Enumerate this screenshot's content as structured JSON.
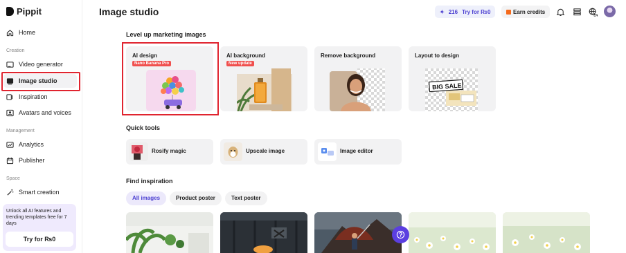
{
  "app": {
    "name": "Pippit"
  },
  "sidebar": {
    "home": "Home",
    "creation_label": "Creation",
    "creation_items": [
      "Video generator",
      "Image studio",
      "Inspiration",
      "Avatars and voices"
    ],
    "management_label": "Management",
    "management_items": [
      "Analytics",
      "Publisher"
    ],
    "space_label": "Space",
    "space_items": [
      "Smart creation"
    ],
    "promo": {
      "text": "Unlock all AI features and trending templates free for 7 days",
      "button": "Try for ₨0"
    }
  },
  "header": {
    "title": "Image studio",
    "credits": "216",
    "try_label": "Try for ₨0",
    "earn_label": "Earn credits"
  },
  "level_up": {
    "heading": "Level up marketing images",
    "cards": [
      {
        "title": "AI design",
        "badge": "Nano Banana Pro"
      },
      {
        "title": "AI background",
        "badge": "New update"
      },
      {
        "title": "Remove background",
        "badge": ""
      },
      {
        "title": "Layout to design",
        "badge": ""
      }
    ],
    "big_sale": "BIG SALE"
  },
  "quick_tools": {
    "heading": "Quick tools",
    "items": [
      "Rosify magic",
      "Upscale image",
      "Image editor"
    ]
  },
  "inspiration": {
    "heading": "Find inspiration",
    "chips": [
      "All images",
      "Product poster",
      "Text poster"
    ]
  },
  "colors": {
    "accent": "#5b3fe0",
    "highlight": "#e0242f",
    "badge": "#f0504e"
  }
}
